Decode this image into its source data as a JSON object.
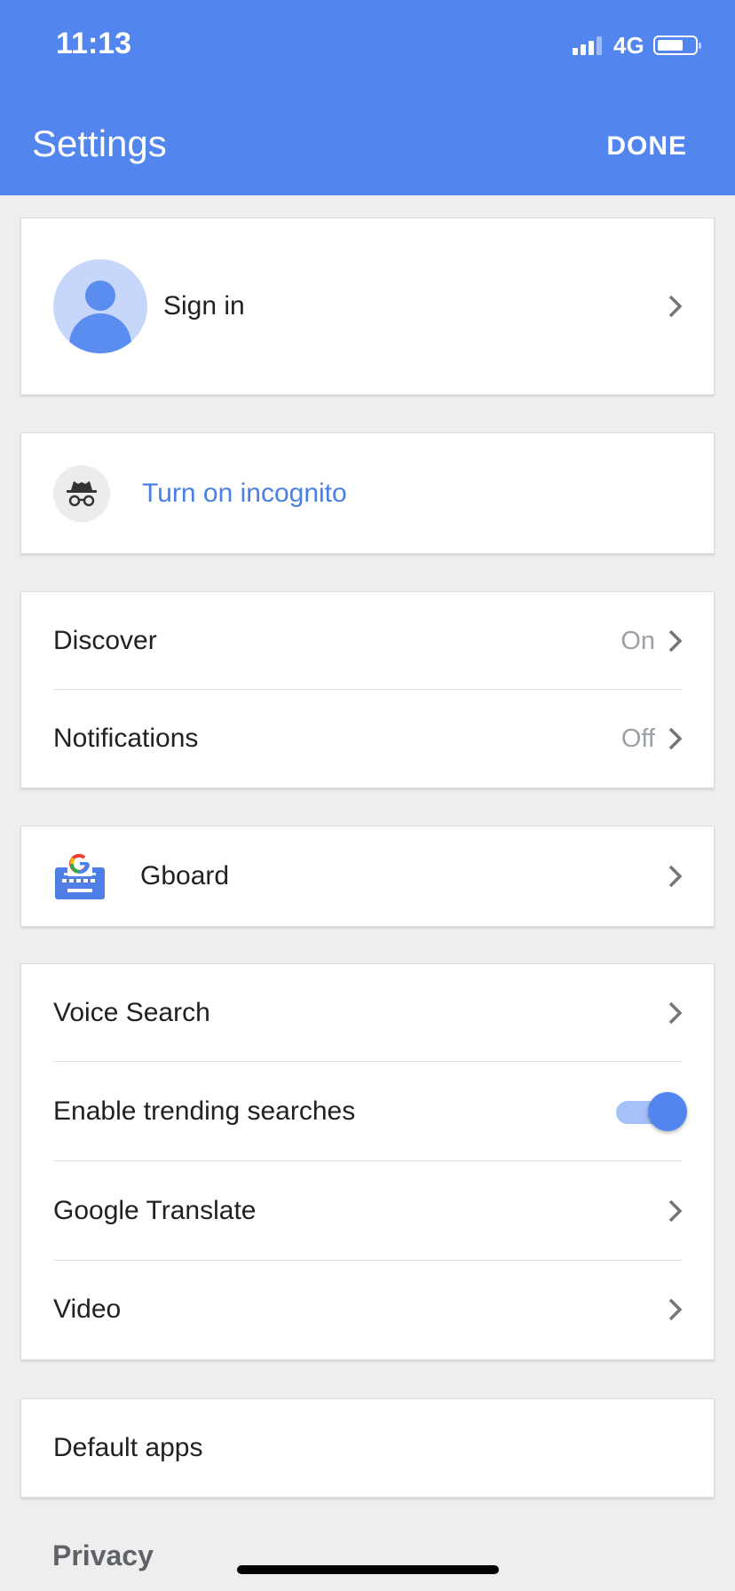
{
  "status_bar": {
    "time": "11:13",
    "network": "4G"
  },
  "header": {
    "title": "Settings",
    "done_label": "DONE"
  },
  "account": {
    "sign_in_label": "Sign in"
  },
  "incognito": {
    "label": "Turn on incognito"
  },
  "feed_group": [
    {
      "label": "Discover",
      "value": "On"
    },
    {
      "label": "Notifications",
      "value": "Off"
    }
  ],
  "keyboard": {
    "label": "Gboard"
  },
  "search_group": {
    "voice_search": "Voice Search",
    "trending": {
      "label": "Enable trending searches",
      "enabled": true
    },
    "translate": "Google Translate",
    "video": "Video"
  },
  "default_apps": {
    "label": "Default apps"
  },
  "section_heading": "Privacy",
  "colors": {
    "accent": "#5385ee",
    "link": "#4a7fe3",
    "background": "#eeeeee"
  }
}
